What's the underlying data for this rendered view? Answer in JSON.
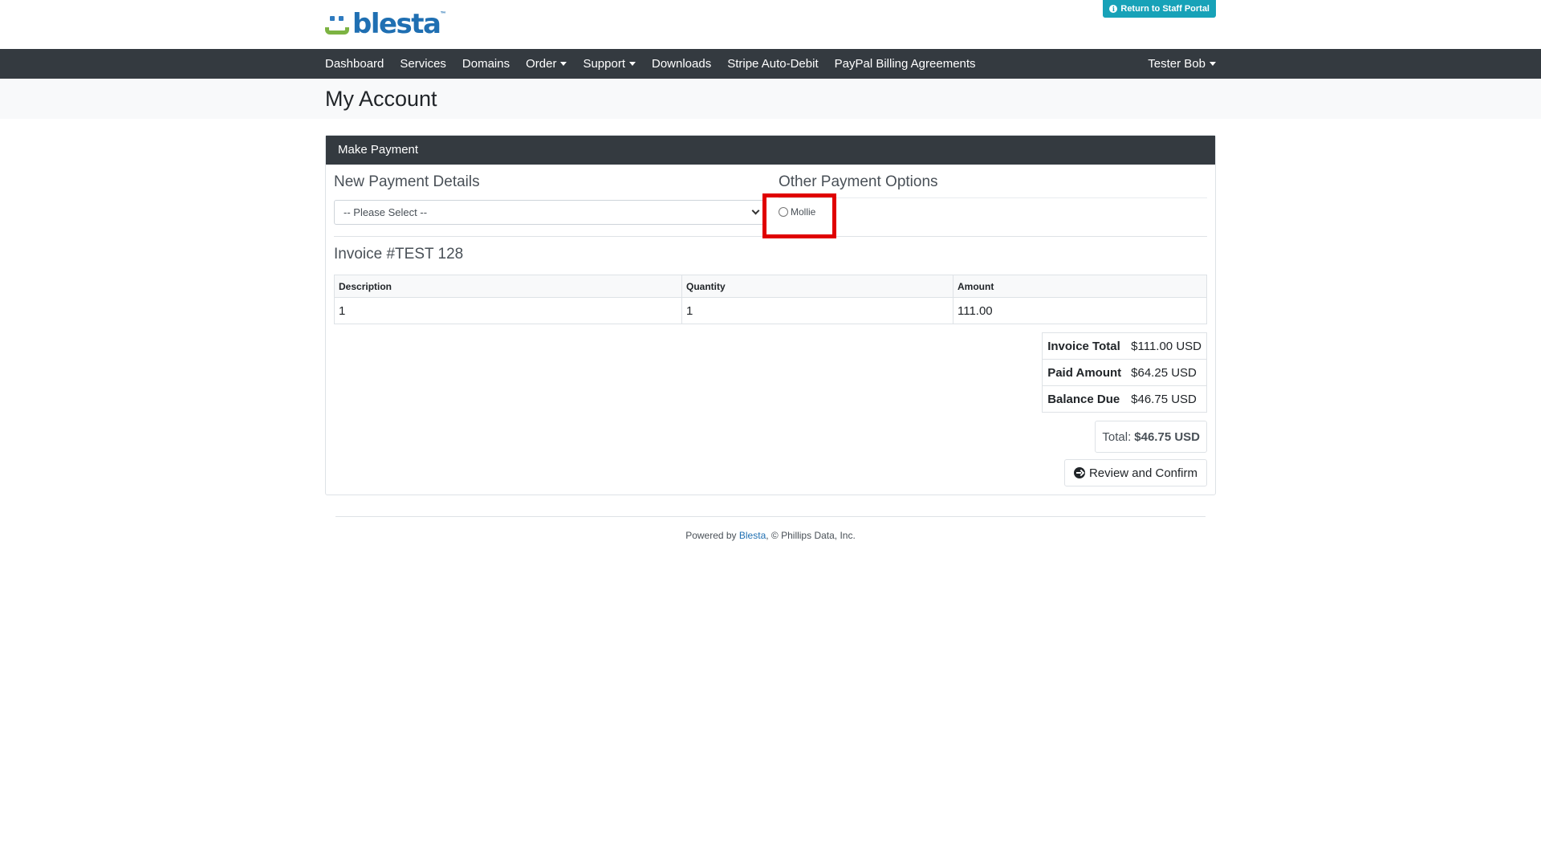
{
  "header": {
    "logo_text": "blesta",
    "logo_tm": "™",
    "staff_button_label": "Return to Staff Portal"
  },
  "nav": {
    "items": [
      {
        "label": "Dashboard",
        "dropdown": false
      },
      {
        "label": "Services",
        "dropdown": false
      },
      {
        "label": "Domains",
        "dropdown": false
      },
      {
        "label": "Order",
        "dropdown": true
      },
      {
        "label": "Support",
        "dropdown": true
      },
      {
        "label": "Downloads",
        "dropdown": false
      },
      {
        "label": "Stripe Auto-Debit",
        "dropdown": false
      },
      {
        "label": "PayPal Billing Agreements",
        "dropdown": false
      }
    ],
    "user_label": "Tester Bob"
  },
  "page": {
    "title": "My Account"
  },
  "card": {
    "header": "Make Payment",
    "new_payment_heading": "New Payment Details",
    "select_value": "-- Please Select --",
    "other_options_heading": "Other Payment Options",
    "other_options": [
      {
        "label": "Mollie",
        "checked": false
      }
    ],
    "invoice_heading": "Invoice #TEST 128",
    "table": {
      "columns": [
        "Description",
        "Quantity",
        "Amount"
      ],
      "rows": [
        [
          "1",
          "1",
          "111.00"
        ]
      ]
    },
    "totals": [
      {
        "label": "Invoice Total",
        "value": "$111.00 USD"
      },
      {
        "label": "Paid Amount",
        "value": "$64.25 USD"
      },
      {
        "label": "Balance Due",
        "value": "$46.75 USD"
      }
    ],
    "grand_total_label": "Total:",
    "grand_total_value": "$46.75 USD",
    "review_button_label": "Review and Confirm"
  },
  "footer": {
    "prefix": "Powered by ",
    "link": "Blesta",
    "suffix": ", © Phillips Data, Inc."
  },
  "colors": {
    "navbar": "#343a40",
    "staff_button": "#17a2b8",
    "highlight": "#e00000",
    "link": "#1f6fb2"
  }
}
